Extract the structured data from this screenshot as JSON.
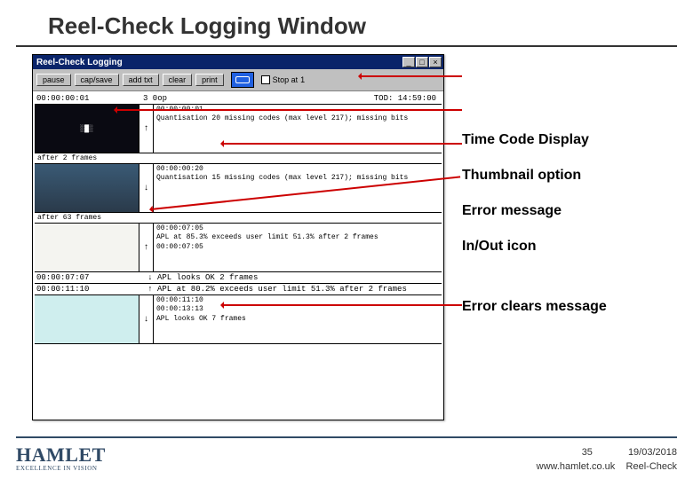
{
  "slide": {
    "title": "Reel-Check Logging Window"
  },
  "window": {
    "title": "Reel-Check Logging",
    "btn_min": "_",
    "btn_max": "□",
    "btn_close": "×"
  },
  "toolbar": {
    "pause": "pause",
    "capsave": "cap/save",
    "addtxt": "add txt",
    "clear": "clear",
    "print": "print",
    "stop_label": "Stop at",
    "stop_value": "1"
  },
  "log": {
    "tc_left": "00:00:00:01",
    "tc_mid": "3    0op",
    "tc_right": "TOD: 14:59:00",
    "row1": {
      "tc": "00:00:00:01",
      "io": "↑",
      "line1": "00:00:00:01",
      "line2": "Quantisation 20 missing codes (max level 217); missing bits"
    },
    "meta1": "after 2 frames",
    "row2": {
      "tc": "00:00:00:20",
      "io": "↓",
      "line1": "00:00:00:20",
      "line2": "Quantisation 15 missing codes (max level 217); missing bits"
    },
    "meta2": "after 63 frames",
    "row3": {
      "tc": "00:00:07:05",
      "io": "↑",
      "line2": "APL at 85.3% exceeds user limit 51.3% after 2 frames"
    },
    "row3b": {
      "line1": "00:00:07:05"
    },
    "row4a": {
      "tc": "00:00:07:07",
      "io": "↓",
      "line": "APL looks OK 2 frames"
    },
    "row4b": {
      "tc": "00:00:11:10",
      "io": "↑",
      "line": "APL at 80.2% exceeds user limit 51.3% after 2 frames"
    },
    "row5": {
      "tc": "00:00:13:13",
      "io": "↓",
      "line1": "00:00:11:10",
      "line2": "APL looks OK 7 frames"
    }
  },
  "annotations": {
    "a1": "Time Code Display",
    "a2": "Thumbnail option",
    "a3": "Error message",
    "a4": "In/Out icon",
    "a5": "Error clears message"
  },
  "footer": {
    "logo": "HAMLET",
    "tag": "EXCELLENCE IN VISION",
    "page": "35",
    "date": "19/03/2018",
    "url": "www.hamlet.co.uk",
    "product": "Reel-Check"
  }
}
